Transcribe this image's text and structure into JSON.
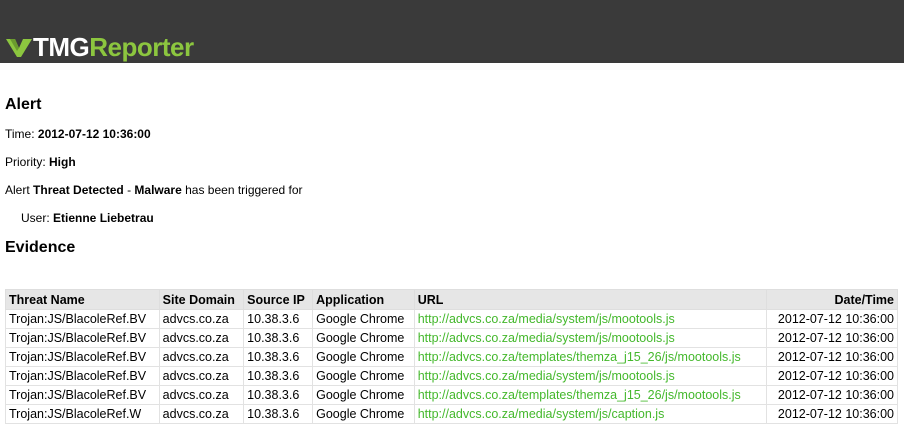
{
  "header": {
    "logo_part1": "TMG",
    "logo_part2": "Reporter",
    "logo_icon": "chevron-v-logo-icon",
    "brand_color": "#8cc63f",
    "bar_color": "#3a3a3a"
  },
  "alert": {
    "heading": "Alert",
    "time_label": "Time:",
    "time_value": "2012-07-12 10:36:00",
    "priority_label": "Priority:",
    "priority_value": "High",
    "msg_prefix": "Alert",
    "alert_name": "Threat Detected",
    "msg_sep": "-",
    "alert_type": "Malware",
    "msg_suffix": "has been triggered for",
    "user_label": "User:",
    "user_value": "Etienne Liebetrau"
  },
  "evidence": {
    "heading": "Evidence",
    "columns": [
      "Threat Name",
      "Site Domain",
      "Source IP",
      "Application",
      "URL",
      "Date/Time"
    ],
    "rows": [
      [
        "Trojan:JS/BlacoleRef.BV",
        "advcs.co.za",
        "10.38.3.6",
        "Google Chrome",
        "http://advcs.co.za/media/system/js/mootools.js",
        "2012-07-12 10:36:00"
      ],
      [
        "Trojan:JS/BlacoleRef.BV",
        "advcs.co.za",
        "10.38.3.6",
        "Google Chrome",
        "http://advcs.co.za/media/system/js/mootools.js",
        "2012-07-12 10:36:00"
      ],
      [
        "Trojan:JS/BlacoleRef.BV",
        "advcs.co.za",
        "10.38.3.6",
        "Google Chrome",
        "http://advcs.co.za/templates/themza_j15_26/js/mootools.js",
        "2012-07-12 10:36:00"
      ],
      [
        "Trojan:JS/BlacoleRef.BV",
        "advcs.co.za",
        "10.38.3.6",
        "Google Chrome",
        "http://advcs.co.za/media/system/js/mootools.js",
        "2012-07-12 10:36:00"
      ],
      [
        "Trojan:JS/BlacoleRef.BV",
        "advcs.co.za",
        "10.38.3.6",
        "Google Chrome",
        "http://advcs.co.za/templates/themza_j15_26/js/mootools.js",
        "2012-07-12 10:36:00"
      ],
      [
        "Trojan:JS/BlacoleRef.W",
        "advcs.co.za",
        "10.38.3.6",
        "Google Chrome",
        "http://advcs.co.za/media/system/js/caption.js",
        "2012-07-12 10:36:00"
      ]
    ],
    "url_color": "#44b82c"
  }
}
